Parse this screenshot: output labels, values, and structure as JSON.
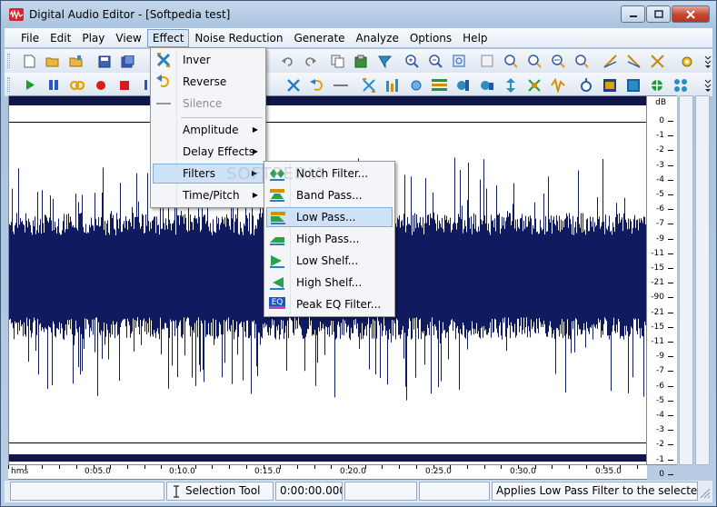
{
  "window": {
    "title": "Digital Audio Editor - [Softpedia test]",
    "accent": "#10164a",
    "wave_color": "#101a5e"
  },
  "menubar": {
    "items": [
      "File",
      "Edit",
      "Play",
      "View",
      "Effect",
      "Noise Reduction",
      "Generate",
      "Analyze",
      "Options",
      "Help"
    ],
    "active": "Effect"
  },
  "effect_menu": {
    "items": [
      {
        "label": "Inver",
        "icon": "invert-icon"
      },
      {
        "label": "Reverse",
        "icon": "reverse-icon"
      },
      {
        "label": "Silence",
        "icon": "silence-icon",
        "disabled": true
      },
      {
        "label": "Amplitude",
        "submenu": true
      },
      {
        "label": "Delay Effects",
        "submenu": true
      },
      {
        "label": "Filters",
        "submenu": true,
        "highlighted": true
      },
      {
        "label": "Time/Pitch",
        "submenu": true
      }
    ]
  },
  "filters_menu": {
    "items": [
      {
        "label": "Notch Filter...",
        "icon": "notch-filter-icon"
      },
      {
        "label": "Band Pass...",
        "icon": "band-pass-icon"
      },
      {
        "label": "Low Pass...",
        "icon": "low-pass-icon",
        "highlighted": true
      },
      {
        "label": "High Pass...",
        "icon": "high-pass-icon"
      },
      {
        "label": "Low Shelf...",
        "icon": "low-shelf-icon"
      },
      {
        "label": "High Shelf...",
        "icon": "high-shelf-icon"
      },
      {
        "label": "Peak EQ Filter...",
        "icon": "peak-eq-icon"
      }
    ],
    "peak_eq_badge": "EQ"
  },
  "db_scale": {
    "unit": "dB",
    "labels": [
      "0",
      "-1",
      "-2",
      "-3",
      "-4",
      "-5",
      "-6",
      "-7",
      "-9",
      "-11",
      "-15",
      "-21",
      "-90",
      "-21",
      "-15",
      "-11",
      "-9",
      "-7",
      "-6",
      "-5",
      "-4",
      "-3",
      "-2",
      "-1",
      "0"
    ]
  },
  "ruler": {
    "labels": [
      "hms",
      "0:05.0",
      "0:10.0",
      "0:15.0",
      "0:20.0",
      "0:25.0",
      "0:30.0",
      "0:35.0"
    ]
  },
  "statusbar": {
    "tool": "Selection Tool",
    "time": "0:00:00.000",
    "message": "Applies Low Pass Filter to the selected part"
  },
  "watermark": "SOFTPEDIA"
}
